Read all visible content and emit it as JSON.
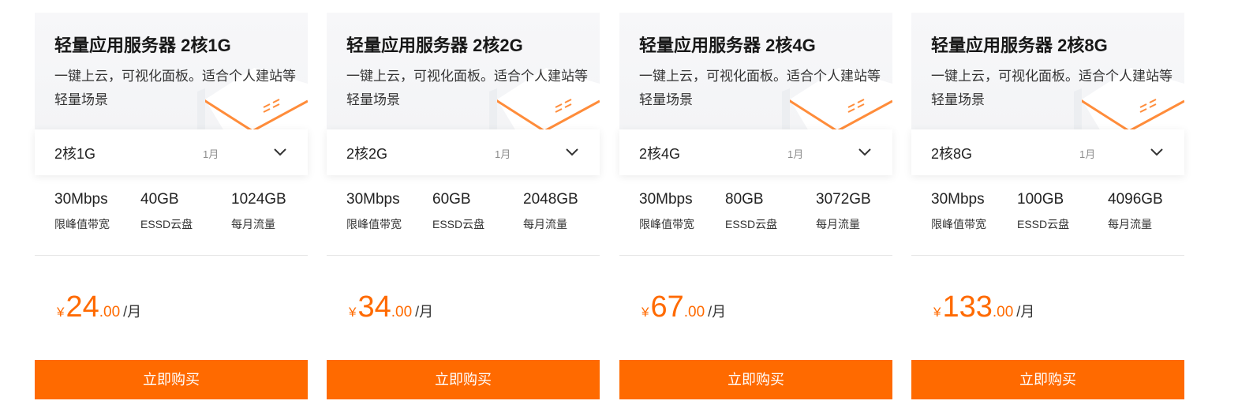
{
  "colors": {
    "accent": "#ff6a00",
    "header_bg": "#f5f5f7"
  },
  "cards": [
    {
      "title": "轻量应用服务器 2核1G",
      "description": "一键上云，可视化面板。适合个人建站等轻量场景",
      "config": "2核1G",
      "period": "1月",
      "specs": [
        {
          "value": "30Mbps",
          "label": "限峰值带宽"
        },
        {
          "value": "40GB",
          "label": "ESSD云盘"
        },
        {
          "value": "1024GB",
          "label": "每月流量"
        }
      ],
      "price": {
        "currency": "¥",
        "integer": "24",
        "decimal": ".00",
        "unit": "/月"
      },
      "buy_label": "立即购买"
    },
    {
      "title": "轻量应用服务器 2核2G",
      "description": "一键上云，可视化面板。适合个人建站等轻量场景",
      "config": "2核2G",
      "period": "1月",
      "specs": [
        {
          "value": "30Mbps",
          "label": "限峰值带宽"
        },
        {
          "value": "60GB",
          "label": "ESSD云盘"
        },
        {
          "value": "2048GB",
          "label": "每月流量"
        }
      ],
      "price": {
        "currency": "¥",
        "integer": "34",
        "decimal": ".00",
        "unit": "/月"
      },
      "buy_label": "立即购买"
    },
    {
      "title": "轻量应用服务器 2核4G",
      "description": "一键上云，可视化面板。适合个人建站等轻量场景",
      "config": "2核4G",
      "period": "1月",
      "specs": [
        {
          "value": "30Mbps",
          "label": "限峰值带宽"
        },
        {
          "value": "80GB",
          "label": "ESSD云盘"
        },
        {
          "value": "3072GB",
          "label": "每月流量"
        }
      ],
      "price": {
        "currency": "¥",
        "integer": "67",
        "decimal": ".00",
        "unit": "/月"
      },
      "buy_label": "立即购买"
    },
    {
      "title": "轻量应用服务器 2核8G",
      "description": "一键上云，可视化面板。适合个人建站等轻量场景",
      "config": "2核8G",
      "period": "1月",
      "specs": [
        {
          "value": "30Mbps",
          "label": "限峰值带宽"
        },
        {
          "value": "100GB",
          "label": "ESSD云盘"
        },
        {
          "value": "4096GB",
          "label": "每月流量"
        }
      ],
      "price": {
        "currency": "¥",
        "integer": "133",
        "decimal": ".00",
        "unit": "/月"
      },
      "buy_label": "立即购买"
    }
  ]
}
